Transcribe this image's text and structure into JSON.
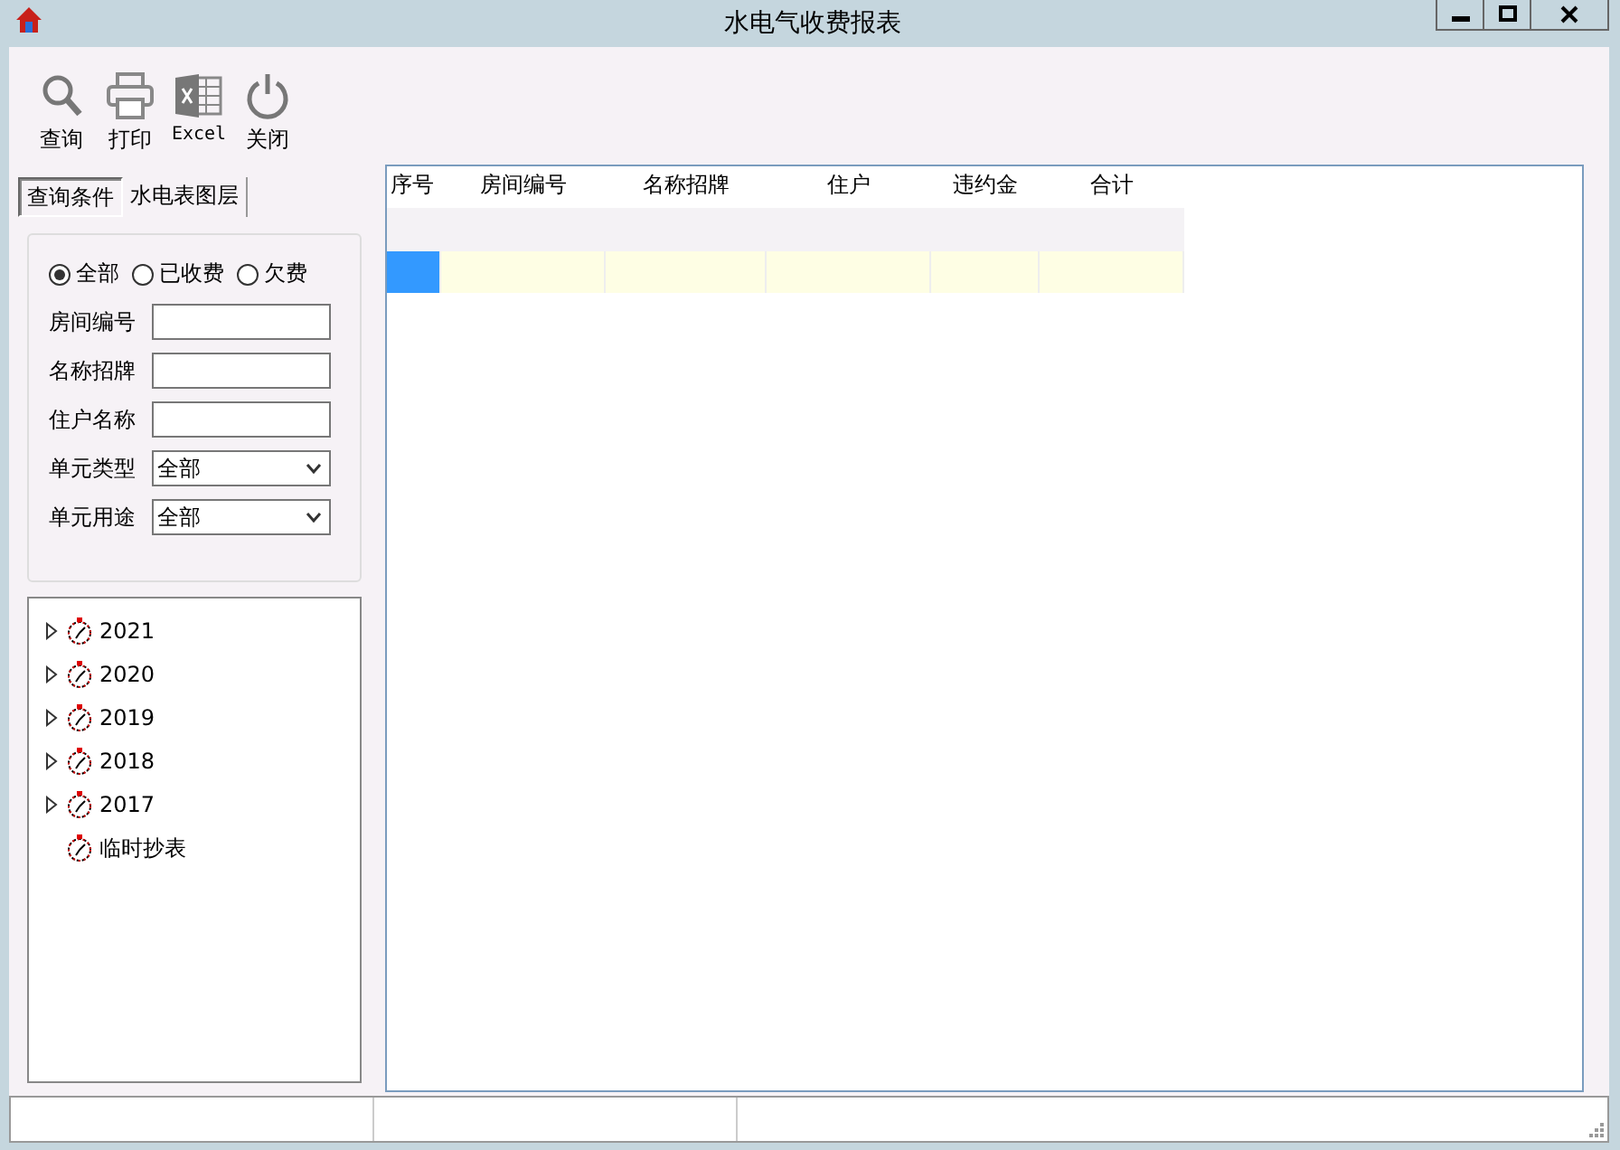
{
  "window": {
    "title": "水电气收费报表"
  },
  "toolbar": [
    {
      "kind": "search",
      "label": "查询"
    },
    {
      "kind": "print",
      "label": "打印"
    },
    {
      "kind": "excel",
      "label": "Excel"
    },
    {
      "kind": "power",
      "label": "关闭"
    }
  ],
  "tabs": [
    {
      "label": "查询条件",
      "selected": true
    },
    {
      "label": "水电表图层",
      "selected": false
    }
  ],
  "filter": {
    "status": [
      {
        "label": "全部",
        "selected": true
      },
      {
        "label": "已收费",
        "selected": false
      },
      {
        "label": "欠费",
        "selected": false
      }
    ],
    "fields": [
      {
        "kind": "text",
        "label": "房间编号"
      },
      {
        "kind": "text",
        "label": "名称招牌"
      },
      {
        "kind": "text",
        "label": "住户名称"
      },
      {
        "kind": "select",
        "label": "单元类型",
        "value": "全部"
      },
      {
        "kind": "select",
        "label": "单元用途",
        "value": "全部"
      }
    ]
  },
  "tree": [
    {
      "kind": "folder",
      "label": "2021",
      "expanded": false
    },
    {
      "kind": "folder",
      "label": "2020",
      "expanded": false
    },
    {
      "kind": "folder",
      "label": "2019",
      "expanded": false
    },
    {
      "kind": "folder",
      "label": "2018",
      "expanded": false
    },
    {
      "kind": "folder",
      "label": "2017",
      "expanded": false
    },
    {
      "kind": "leaf",
      "label": "临时抄表"
    }
  ],
  "table": {
    "columns": [
      "序号",
      "房间编号",
      "名称招牌",
      "住户",
      "违约金",
      "合计"
    ],
    "rows": [
      {
        "selected": true
      }
    ]
  }
}
